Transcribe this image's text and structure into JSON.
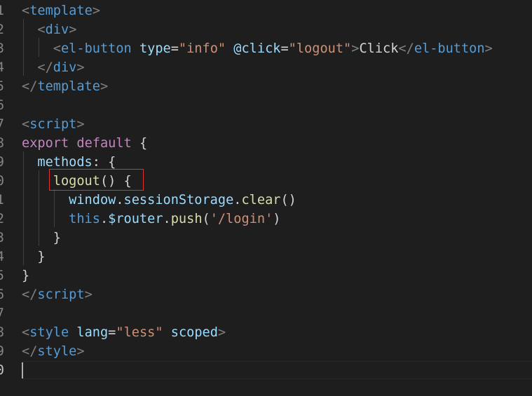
{
  "editor": {
    "language": "vue",
    "colors": {
      "background": "#1e1e1e",
      "tag_bracket": "#808080",
      "tag_name": "#569cd6",
      "attribute": "#9cdcfe",
      "string": "#ce9178",
      "keyword": "#c586c0",
      "function": "#dcdcaa",
      "highlight_box": "#e0302c"
    },
    "gutter": [
      "1",
      "2",
      "3",
      "4",
      "5",
      "6",
      "7",
      "8",
      "9",
      "0",
      "1",
      "2",
      "3",
      "4",
      "5",
      "6",
      "7",
      "8",
      "9",
      "0"
    ],
    "lines": [
      [
        {
          "c": "tg",
          "t": "<"
        },
        {
          "c": "tn",
          "t": "template"
        },
        {
          "c": "tg",
          "t": ">"
        }
      ],
      [
        {
          "c": "tx",
          "t": "  "
        },
        {
          "c": "tg",
          "t": "<"
        },
        {
          "c": "tn",
          "t": "div"
        },
        {
          "c": "tg",
          "t": ">"
        }
      ],
      [
        {
          "c": "tx",
          "t": "    "
        },
        {
          "c": "tg",
          "t": "<"
        },
        {
          "c": "tn",
          "t": "el-button"
        },
        {
          "c": "tx",
          "t": " "
        },
        {
          "c": "at",
          "t": "type"
        },
        {
          "c": "tx",
          "t": "="
        },
        {
          "c": "sv",
          "t": "\"info\""
        },
        {
          "c": "tx",
          "t": " "
        },
        {
          "c": "at",
          "t": "@click"
        },
        {
          "c": "tx",
          "t": "="
        },
        {
          "c": "sv",
          "t": "\"logout\""
        },
        {
          "c": "tg",
          "t": ">"
        },
        {
          "c": "tx",
          "t": "Click"
        },
        {
          "c": "tg",
          "t": "</"
        },
        {
          "c": "tn",
          "t": "el-button"
        },
        {
          "c": "tg",
          "t": ">"
        }
      ],
      [
        {
          "c": "tx",
          "t": "  "
        },
        {
          "c": "tg",
          "t": "</"
        },
        {
          "c": "tn",
          "t": "div"
        },
        {
          "c": "tg",
          "t": ">"
        }
      ],
      [
        {
          "c": "tg",
          "t": "</"
        },
        {
          "c": "tn",
          "t": "template"
        },
        {
          "c": "tg",
          "t": ">"
        }
      ],
      [],
      [
        {
          "c": "tg",
          "t": "<"
        },
        {
          "c": "tn",
          "t": "script"
        },
        {
          "c": "tg",
          "t": ">"
        }
      ],
      [
        {
          "c": "kw",
          "t": "export"
        },
        {
          "c": "tx",
          "t": " "
        },
        {
          "c": "kw",
          "t": "default"
        },
        {
          "c": "tx",
          "t": " {"
        }
      ],
      [
        {
          "c": "tx",
          "t": "  "
        },
        {
          "c": "pr",
          "t": "methods"
        },
        {
          "c": "tx",
          "t": ": {"
        }
      ],
      [
        {
          "c": "tx",
          "t": "    "
        },
        {
          "c": "fn",
          "t": "logout"
        },
        {
          "c": "tx",
          "t": "() {"
        }
      ],
      [
        {
          "c": "tx",
          "t": "      "
        },
        {
          "c": "pr",
          "t": "window"
        },
        {
          "c": "tx",
          "t": "."
        },
        {
          "c": "pr",
          "t": "sessionStorage"
        },
        {
          "c": "tx",
          "t": "."
        },
        {
          "c": "fn",
          "t": "clear"
        },
        {
          "c": "tx",
          "t": "()"
        }
      ],
      [
        {
          "c": "tx",
          "t": "      "
        },
        {
          "c": "bl",
          "t": "this"
        },
        {
          "c": "tx",
          "t": "."
        },
        {
          "c": "pr",
          "t": "$router"
        },
        {
          "c": "tx",
          "t": "."
        },
        {
          "c": "fn",
          "t": "push"
        },
        {
          "c": "tx",
          "t": "("
        },
        {
          "c": "sv",
          "t": "'/login'"
        },
        {
          "c": "tx",
          "t": ")"
        }
      ],
      [
        {
          "c": "tx",
          "t": "    }"
        }
      ],
      [
        {
          "c": "tx",
          "t": "  }"
        }
      ],
      [
        {
          "c": "tx",
          "t": "}"
        }
      ],
      [
        {
          "c": "tg",
          "t": "</"
        },
        {
          "c": "tn",
          "t": "script"
        },
        {
          "c": "tg",
          "t": ">"
        }
      ],
      [],
      [
        {
          "c": "tg",
          "t": "<"
        },
        {
          "c": "tn",
          "t": "style"
        },
        {
          "c": "tx",
          "t": " "
        },
        {
          "c": "at",
          "t": "lang"
        },
        {
          "c": "tx",
          "t": "="
        },
        {
          "c": "sv",
          "t": "\"less\""
        },
        {
          "c": "tx",
          "t": " "
        },
        {
          "c": "at",
          "t": "scoped"
        },
        {
          "c": "tg",
          "t": ">"
        }
      ],
      [
        {
          "c": "tg",
          "t": "</"
        },
        {
          "c": "tn",
          "t": "style"
        },
        {
          "c": "tg",
          "t": ">"
        }
      ],
      []
    ],
    "active_line_index": 19
  }
}
